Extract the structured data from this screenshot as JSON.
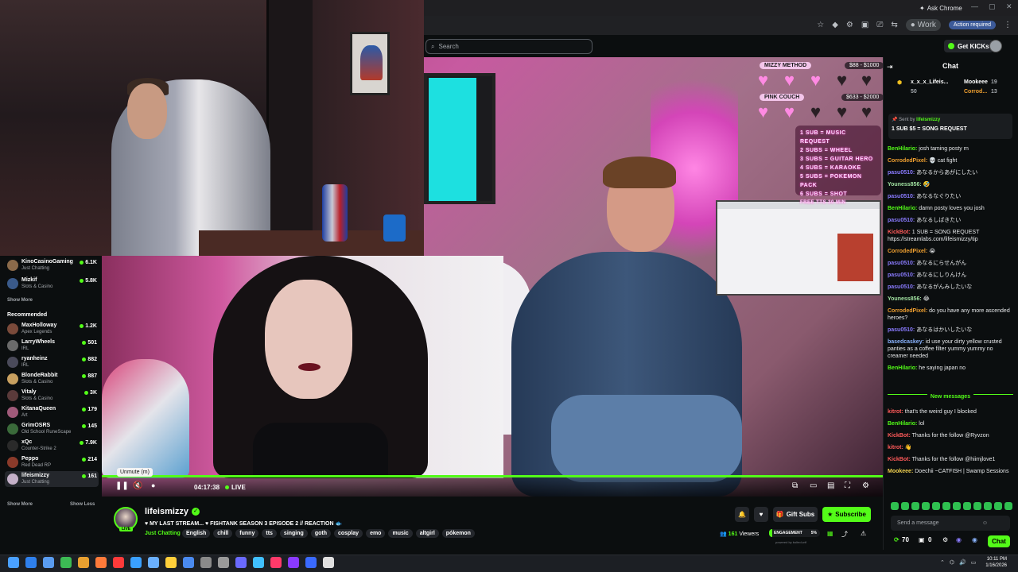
{
  "browser": {
    "ask_chrome": "Ask Chrome",
    "profile": "Work",
    "action": "Action required"
  },
  "kick": {
    "search_placeholder": "Search",
    "get_kicks": "Get KICKs"
  },
  "sidebar": {
    "top_channels": [
      {
        "name": "KinoCasinoGaming",
        "category": "Just Chatting",
        "viewers": "6.1K",
        "color": "#8a6a4a"
      },
      {
        "name": "Mizkif",
        "category": "Slots & Casino",
        "viewers": "5.8K",
        "color": "#3a5a8a"
      }
    ],
    "show_more_1": "Show More",
    "recommended_header": "Recommended",
    "recommended": [
      {
        "name": "MaxHolloway",
        "category": "Apex Legends",
        "viewers": "1.2K",
        "color": "#7a4a3a"
      },
      {
        "name": "LarryWheels",
        "category": "IRL",
        "viewers": "501",
        "color": "#6a6a6a"
      },
      {
        "name": "ryanheinz",
        "category": "IRL",
        "viewers": "882",
        "color": "#4a4a5a"
      },
      {
        "name": "BlondeRabbit",
        "category": "Slots & Casino",
        "viewers": "887",
        "color": "#c8a060"
      },
      {
        "name": "Vitaly",
        "category": "Slots & Casino",
        "viewers": "3K",
        "color": "#5a3a3a"
      },
      {
        "name": "KitanaQueen",
        "category": "Art",
        "viewers": "179",
        "color": "#a05a7a"
      },
      {
        "name": "GrimOSRS",
        "category": "Old School RuneScape",
        "viewers": "145",
        "color": "#3a6a3a"
      },
      {
        "name": "xQc",
        "category": "Counter-Strike 2",
        "viewers": "7.9K",
        "color": "#2a2a2a"
      },
      {
        "name": "Peppo",
        "category": "Red Dead RP",
        "viewers": "214",
        "color": "#8a3a2a"
      },
      {
        "name": "lifeismizzy",
        "category": "Just Chatting",
        "viewers": "161",
        "color": "#c4b0c8"
      }
    ],
    "show_more_2": "Show More",
    "show_less": "Show Less"
  },
  "overlay": {
    "mizzy_method": "MIZZY METHOD",
    "mizzy_price": "$88 - $1000",
    "pink_couch": "PINK COUCH",
    "pink_price": "$633 - $2000",
    "rules": [
      "1 SUB = MUSIC REQUEST",
      "2 SUBS = WHEEL",
      "3 SUBS = GUITAR HERO",
      "4 SUBS = KARAOKE",
      "5 SUBS = POKEMON PACK",
      "6 SUBS = SHOT",
      "FREE TTS 30 MIN"
    ]
  },
  "player": {
    "tooltip": "Unmute (m)",
    "time": "04:17:38",
    "live": "LIVE"
  },
  "stream": {
    "username": "lifeismizzy",
    "title": "♥ MY LAST STREAM... ♥ FISHTANK SEASON 3 EPISODE 2 // REACTION 🐟",
    "category": "Just Chatting",
    "tags": [
      "English",
      "chill",
      "funny",
      "tts",
      "singing",
      "goth",
      "cosplay",
      "emo",
      "music",
      "altgirl",
      "pókemon"
    ],
    "gift_subs": "Gift Subs",
    "subscribe": "Subscribe",
    "viewers": "161",
    "viewers_label": "Viewers",
    "engagement": "ENGAGEMENT",
    "engagement_pct": "5%",
    "engagement_value": 0.05,
    "powered": "powered by bolted.wtf",
    "live_badge": "LIVE"
  },
  "chat": {
    "title": "Chat",
    "leaders": [
      {
        "name": "x_x_x_Lifeis...",
        "count": "50"
      },
      {
        "name": "Mookeee",
        "count": "19"
      },
      {
        "name": "Corrod...",
        "count": "13"
      }
    ],
    "pinned_by": "Sent by",
    "pinned_user": "lifeismizzy",
    "pinned_text": "1 SUB $5 = SONG REQUEST",
    "messages": [
      {
        "user": "BenHilario:",
        "color": "#53fc18",
        "text": "josh taming posty rn"
      },
      {
        "user": "CorrodedPixel:",
        "color": "#f0a030",
        "text": "💀 cat fight"
      },
      {
        "user": "pasu0510:",
        "color": "#8a7bff",
        "text": "あなるからあがにしたい"
      },
      {
        "user": "Youness856:",
        "color": "#a0e0a0",
        "text": "🤣"
      },
      {
        "user": "pasu0510:",
        "color": "#8a7bff",
        "text": "あなるなぐりたい"
      },
      {
        "user": "BenHilario:",
        "color": "#53fc18",
        "text": "damn posty loves you josh"
      },
      {
        "user": "pasu0510:",
        "color": "#8a7bff",
        "text": "あなるしばきたい"
      },
      {
        "user": "KickBot:",
        "color": "#ff5a5a",
        "text": "1 SUB = SONG REQUEST https://streamlabs.com/lifeismizzy/tip"
      },
      {
        "user": "CorrodedPixel:",
        "color": "#f0a030",
        "text": "😭"
      },
      {
        "user": "pasu0510:",
        "color": "#8a7bff",
        "text": "あなるにらせんがん"
      },
      {
        "user": "pasu0510:",
        "color": "#8a7bff",
        "text": "あなるにしりんけん"
      },
      {
        "user": "pasu0510:",
        "color": "#8a7bff",
        "text": "あなるがんみしたいな"
      },
      {
        "user": "Youness856:",
        "color": "#a0e0a0",
        "text": "😂"
      },
      {
        "user": "CorrodedPixel:",
        "color": "#f0a030",
        "text": "do you have any more ascended heroes?"
      },
      {
        "user": "pasu0510:",
        "color": "#8a7bff",
        "text": "あなるはかいしたいな"
      },
      {
        "user": "basedcaskey:",
        "color": "#8ab4ff",
        "text": "id use your dirty yellow crusted panties as a coffee filter yummy yummy no creamer needed"
      },
      {
        "user": "BenHilario:",
        "color": "#53fc18",
        "text": "he saying japan no"
      }
    ],
    "new_messages": "New messages",
    "messages2": [
      {
        "user": "kitrot:",
        "color": "#ff5a5a",
        "text": "that's the weird guy I blocked"
      },
      {
        "user": "BenHilario:",
        "color": "#53fc18",
        "text": "lol"
      },
      {
        "user": "KickBot:",
        "color": "#ff5a5a",
        "text": "Thanks for the follow @Ryvzon"
      },
      {
        "user": "kitrot:",
        "color": "#ff5a5a",
        "text": "👋"
      },
      {
        "user": "KickBot:",
        "color": "#ff5a5a",
        "text": "Thanks for the follow @hiimjlove1"
      },
      {
        "user": "Mookeee:",
        "color": "#f0d050",
        "text": "Doechii ~CATFISH | Swamp Sessions"
      }
    ],
    "send_placeholder": "Send a message",
    "kicks_count": "70",
    "gift_count": "0",
    "chat_button": "Chat"
  },
  "taskbar": {
    "time": "10:11 PM",
    "date": "1/16/2026"
  }
}
